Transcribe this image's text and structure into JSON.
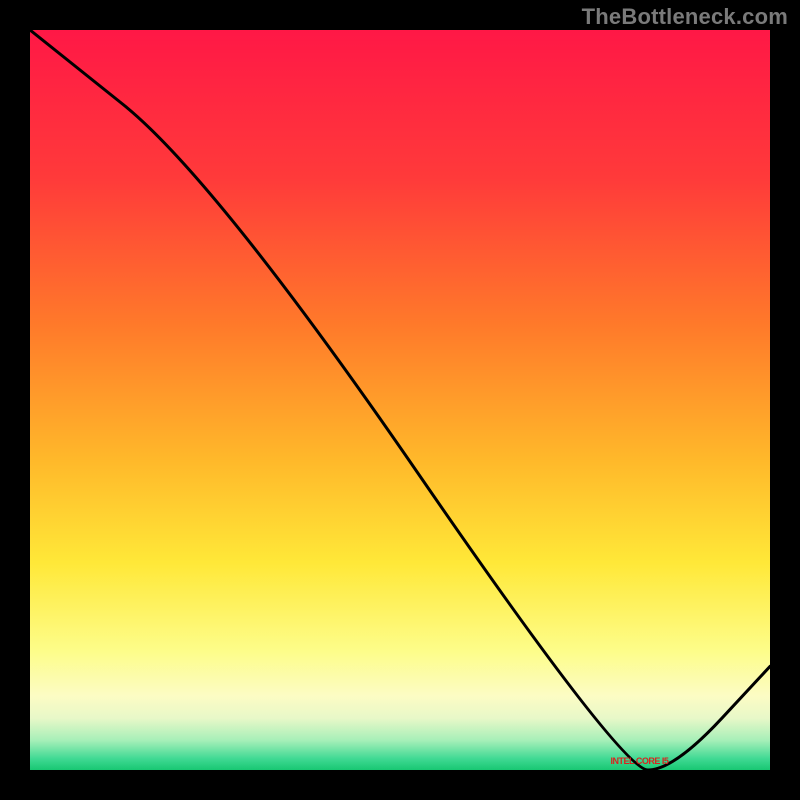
{
  "attribution": "TheBottleneck.com",
  "min_label": "INTEL CORE I5",
  "chart_data": {
    "type": "line",
    "title": "",
    "xlabel": "",
    "ylabel": "",
    "ylim": [
      0,
      100
    ],
    "xlim": [
      0,
      100
    ],
    "series": [
      {
        "name": "bottleneck-curve",
        "x": [
          0,
          25,
          80,
          87,
          100
        ],
        "values": [
          100,
          80,
          0,
          0,
          14
        ]
      }
    ],
    "gradient_stops": [
      {
        "pct": 0,
        "color": "#ff1846"
      },
      {
        "pct": 20,
        "color": "#ff3a3a"
      },
      {
        "pct": 40,
        "color": "#ff7a2a"
      },
      {
        "pct": 58,
        "color": "#ffb82a"
      },
      {
        "pct": 72,
        "color": "#ffe838"
      },
      {
        "pct": 84,
        "color": "#fdfd8a"
      },
      {
        "pct": 90,
        "color": "#fcfcc4"
      },
      {
        "pct": 93,
        "color": "#e8f8c8"
      },
      {
        "pct": 96,
        "color": "#a6efb8"
      },
      {
        "pct": 98.5,
        "color": "#3fd993"
      },
      {
        "pct": 100,
        "color": "#18c772"
      }
    ],
    "min_marker": {
      "x_start": 76,
      "x_end": 89,
      "y": 0
    }
  }
}
